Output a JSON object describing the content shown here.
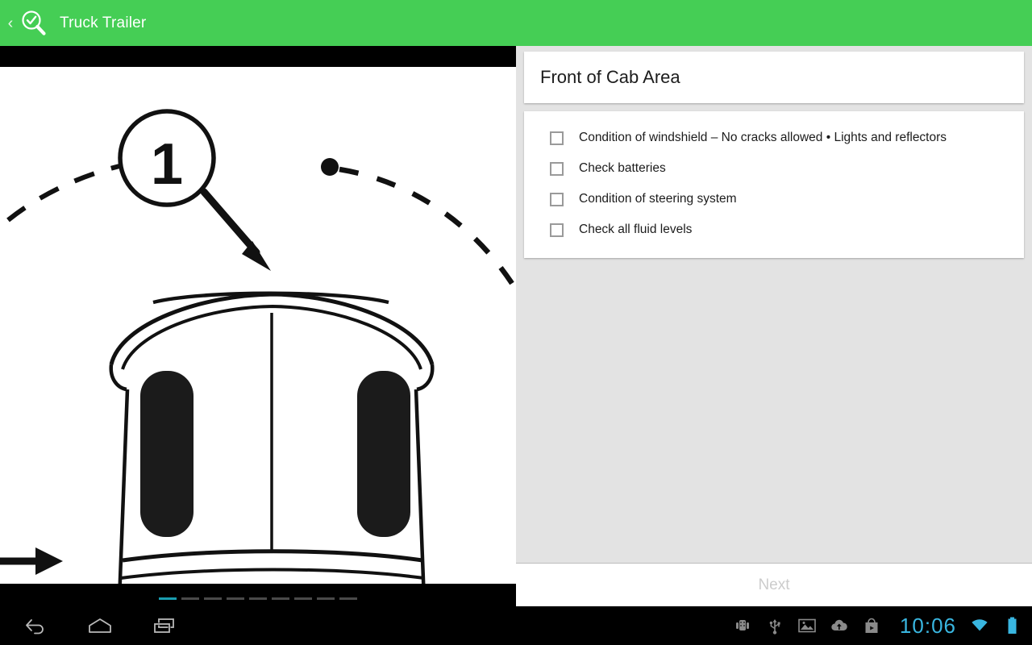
{
  "actionbar": {
    "back_label": "‹",
    "back_icon": "back-chevron-icon",
    "logo_icon": "magnifier-check-logo",
    "title": "Truck Trailer",
    "green": "#45ce55"
  },
  "illustration": {
    "step_number": "1",
    "marker_icon": "numbered-step-marker",
    "path_icon": "dashed-arc-path",
    "arrow_icon": "pointer-arrow",
    "subject_icon": "truck-cab-front-illustration",
    "alt": "Front view line drawing of a truck cab with step 1 marker"
  },
  "pager": {
    "total": 9,
    "active_index": 0,
    "active_color": "#1a9eb0",
    "inactive_color": "#4a4a4a"
  },
  "section": {
    "title": "Front of Cab Area"
  },
  "checklist": {
    "items": [
      {
        "label": "Condition of windshield – No cracks allowed • Lights and reflectors",
        "checked": false
      },
      {
        "label": "Check batteries",
        "checked": false
      },
      {
        "label": "Condition of steering system",
        "checked": false
      },
      {
        "label": "Check all fluid levels",
        "checked": false
      }
    ]
  },
  "footer": {
    "next_label": "Next",
    "next_enabled": false,
    "disabled_color": "#cccccc"
  },
  "navbar": {
    "buttons": [
      {
        "name": "back-nav-button",
        "icon": "back-arrow-icon"
      },
      {
        "name": "home-nav-button",
        "icon": "home-icon"
      },
      {
        "name": "recents-nav-button",
        "icon": "recent-apps-icon"
      }
    ],
    "status_icons": [
      {
        "name": "android-debug-icon"
      },
      {
        "name": "usb-icon"
      },
      {
        "name": "screenshot-image-icon"
      },
      {
        "name": "cloud-upload-icon"
      },
      {
        "name": "play-store-icon"
      }
    ],
    "clock": "10:06",
    "clock_color": "#39b6e0",
    "wifi_icon": "wifi-icon",
    "battery_icon": "battery-full-icon"
  }
}
